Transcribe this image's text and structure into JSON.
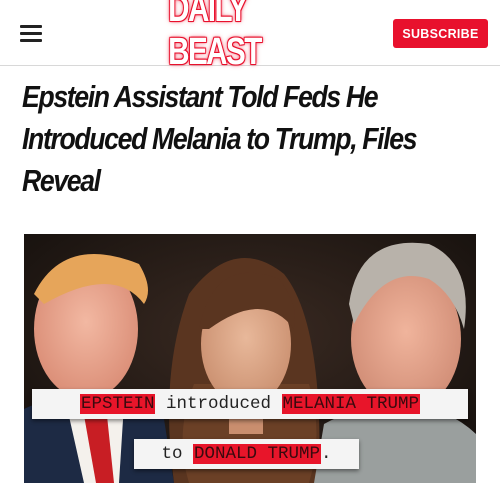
{
  "header": {
    "logo_text": "DAILY BEAST",
    "subscribe_label": "SUBSCRIBE",
    "menu_icon": "hamburger-menu-icon",
    "brand_color": "#e8112d"
  },
  "article": {
    "headline": "Epstein Assistant Told Feds He Introduced Melania to Trump, Files Reveal"
  },
  "hero_caption": {
    "line1_highlight1": "EPSTEIN",
    "line1_middle": " introduced ",
    "line1_highlight2": "MELANIA TRUMP",
    "line2_prefix": "to ",
    "line2_highlight": "DONALD TRUMP",
    "line2_suffix": ".",
    "highlight_color": "#e8152a"
  }
}
